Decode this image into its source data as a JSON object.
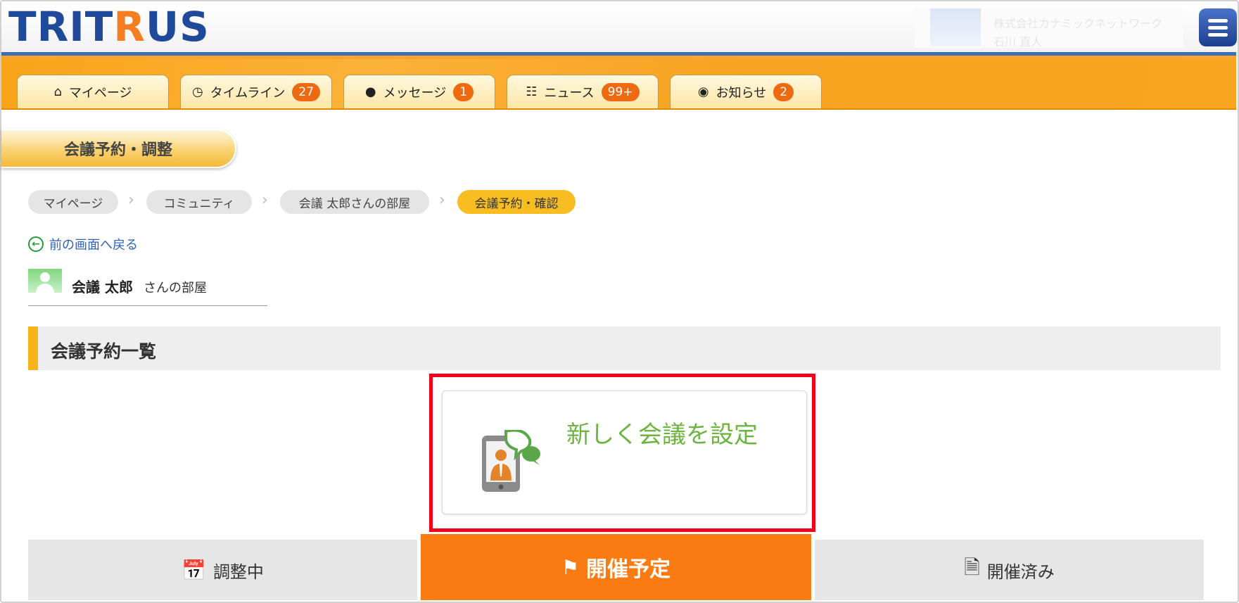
{
  "header": {
    "logo_part1": "TRIT",
    "logo_part2": "R",
    "logo_part3": "US",
    "user_company": "株式会社カナミックネットワーク",
    "user_name": "石川 直人"
  },
  "nav_tabs": [
    {
      "icon": "home-icon",
      "label": "マイページ",
      "badge": ""
    },
    {
      "icon": "clock-icon",
      "label": "タイムライン",
      "badge": "27"
    },
    {
      "icon": "chat-icon",
      "label": "メッセージ",
      "badge": "1"
    },
    {
      "icon": "book-icon",
      "label": "ニュース",
      "badge": "99+"
    },
    {
      "icon": "notice-icon",
      "label": "お知らせ",
      "badge": "2"
    }
  ],
  "page_title": "会議予約・調整",
  "breadcrumb": [
    "マイページ",
    "コミュニティ",
    "会議 太郎さんの部屋",
    "会議予約・確認"
  ],
  "back_link": "前の画面へ戻る",
  "owner": {
    "name": "会議 太郎",
    "suffix": "さんの部屋"
  },
  "section_title": "会議予約一覧",
  "new_meeting_label": "新しく会議を設定",
  "bottom_tabs": [
    {
      "icon": "calendar-icon",
      "label": "調整中",
      "state": "inactive"
    },
    {
      "icon": "flag-icon",
      "label": "開催予定",
      "state": "active"
    },
    {
      "icon": "document-icon",
      "label": "開催済み",
      "state": "inactive"
    }
  ],
  "colors": {
    "brand_blue": "#1f4a9a",
    "brand_orange": "#f47d20",
    "nav_orange": "#f9a41a",
    "active_tab": "#fa7b12",
    "highlight_red": "#f0001a",
    "link_blue": "#2f62b7",
    "new_meeting_green": "#6db33f"
  }
}
